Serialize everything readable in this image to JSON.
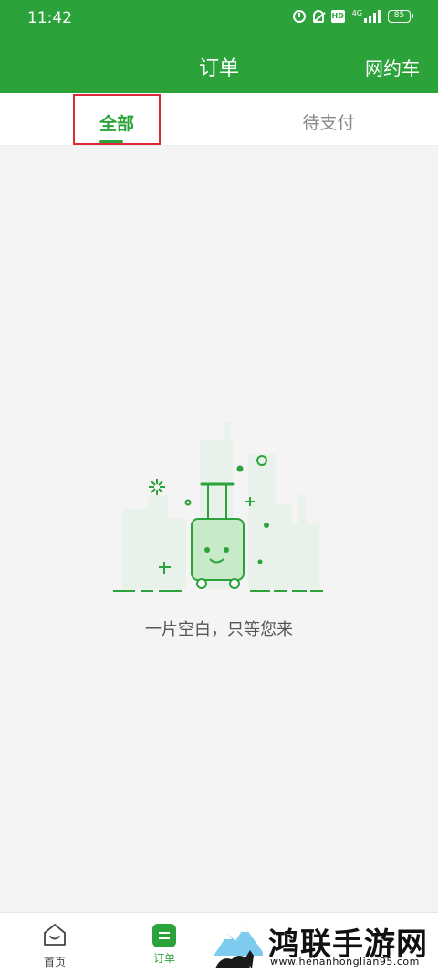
{
  "status_bar": {
    "time": "11:42",
    "network": "4G",
    "battery": "85"
  },
  "nav": {
    "title": "订单",
    "right_action": "网约车"
  },
  "tabs": [
    {
      "label": "全部",
      "active": true
    },
    {
      "label": "待支付",
      "active": false
    }
  ],
  "empty_state": {
    "message": "一片空白，只等您来",
    "icon": "luggage-icon"
  },
  "bottom_nav": [
    {
      "label": "首页",
      "icon": "home-icon",
      "active": false
    },
    {
      "label": "订单",
      "icon": "order-icon",
      "active": true
    }
  ],
  "watermark": {
    "title": "鸿联手游网",
    "url": "www.henanhonglian95.com"
  },
  "colors": {
    "primary": "#2ba33a",
    "highlight_box": "#e0283a",
    "background": "#f4f4f4"
  }
}
